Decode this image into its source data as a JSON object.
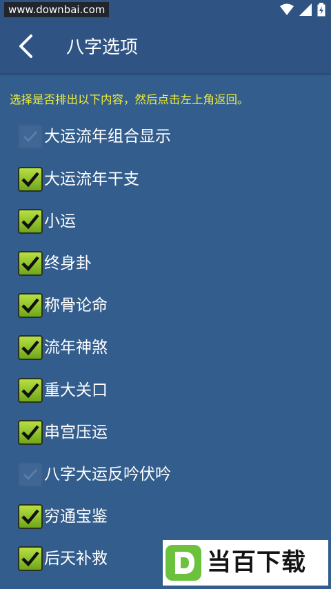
{
  "status_bar": {
    "watermark": "www.downbai.com",
    "icons": [
      "wifi-icon",
      "signal-icon",
      "battery-icon"
    ]
  },
  "app_bar": {
    "back_icon": "chevron-left-icon",
    "title": "八字选项"
  },
  "instruction": "选择是否排出以下内容，然后点击左上角返回。",
  "options": [
    {
      "label": "大运流年组合显示",
      "checked": false
    },
    {
      "label": "大运流年干支",
      "checked": true
    },
    {
      "label": "小运",
      "checked": true
    },
    {
      "label": "终身卦",
      "checked": true
    },
    {
      "label": "称骨论命",
      "checked": true
    },
    {
      "label": "流年神煞",
      "checked": true
    },
    {
      "label": "重大关口",
      "checked": true
    },
    {
      "label": "串宫压运",
      "checked": true
    },
    {
      "label": "八字大运反吟伏吟",
      "checked": false
    },
    {
      "label": "穷通宝鉴",
      "checked": true
    },
    {
      "label": "后天补救",
      "checked": true
    }
  ],
  "bottom_watermark": {
    "text": "当百下载",
    "logo_letter": "D"
  },
  "colors": {
    "background": "#335d8c",
    "app_bar": "#2f5483",
    "instruction_text": "#f1ef3a",
    "checkbox_on": "#8cc22a"
  }
}
